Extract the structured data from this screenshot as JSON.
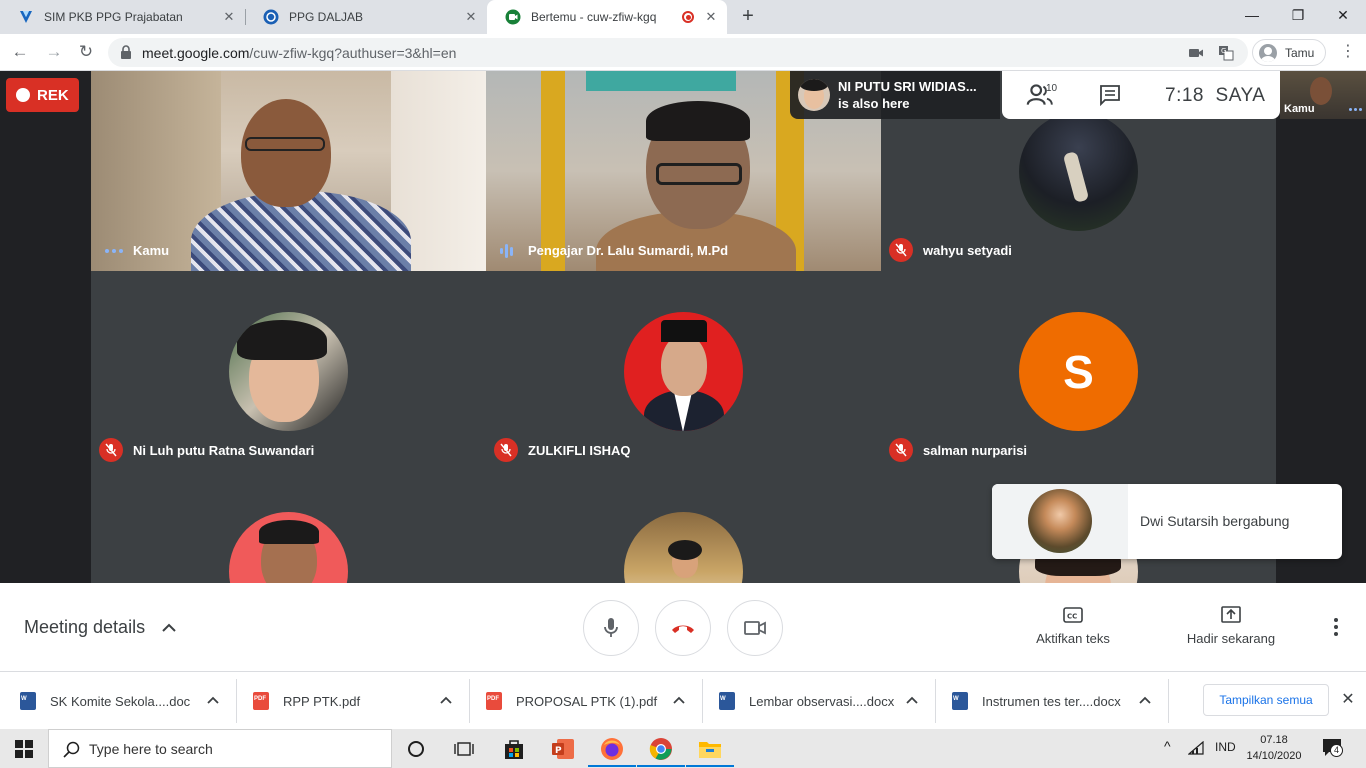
{
  "browser": {
    "tabs": [
      {
        "title": "SIM PKB PPG Prajabatan",
        "active": false
      },
      {
        "title": "PPG DALJAB",
        "active": false
      },
      {
        "title": "Bertemu - cuw-zfiw-kgq",
        "active": true
      }
    ],
    "url_host": "meet.google.com",
    "url_path": "/cuw-zfiw-kgq?authuser=3&hl=en",
    "profile_name": "Tamu"
  },
  "meet": {
    "recording_label": "REK",
    "notice_name": "NI PUTU SRI WIDIAS...",
    "notice_text": "is also here",
    "participant_count": "10",
    "time": "7:18",
    "self_label_top": "SAYA",
    "self_tile_label": "Kamu",
    "tiles": [
      {
        "name": "Kamu"
      },
      {
        "name": "Pengajar Dr. Lalu Sumardi, M.Pd"
      },
      {
        "name": "wahyu setyadi"
      },
      {
        "name": "Ni Luh putu Ratna Suwandari"
      },
      {
        "name": "ZULKIFLI ISHAQ"
      },
      {
        "name": "salman nurparisi"
      }
    ],
    "letter_avatar": "S",
    "toast_text": "Dwi Sutarsih bergabung",
    "meeting_details": "Meeting details",
    "captions_label": "Aktifkan teks",
    "present_label": "Hadir sekarang",
    "colors": {
      "red": "#d93025",
      "orange": "#ef6c00",
      "accent": "#8ab4f8"
    }
  },
  "downloads": {
    "items": [
      {
        "name": "SK Komite Sekola....doc",
        "type": "word"
      },
      {
        "name": "RPP PTK.pdf",
        "type": "pdf"
      },
      {
        "name": "PROPOSAL PTK (1).pdf",
        "type": "pdf"
      },
      {
        "name": "Lembar observasi....docx",
        "type": "word"
      },
      {
        "name": "Instrumen tes ter....docx",
        "type": "word"
      }
    ],
    "show_all": "Tampilkan semua"
  },
  "taskbar": {
    "search_placeholder": "Type here to search",
    "lang": "IND",
    "time": "07.18",
    "date": "14/10/2020",
    "notif_count": "4"
  }
}
